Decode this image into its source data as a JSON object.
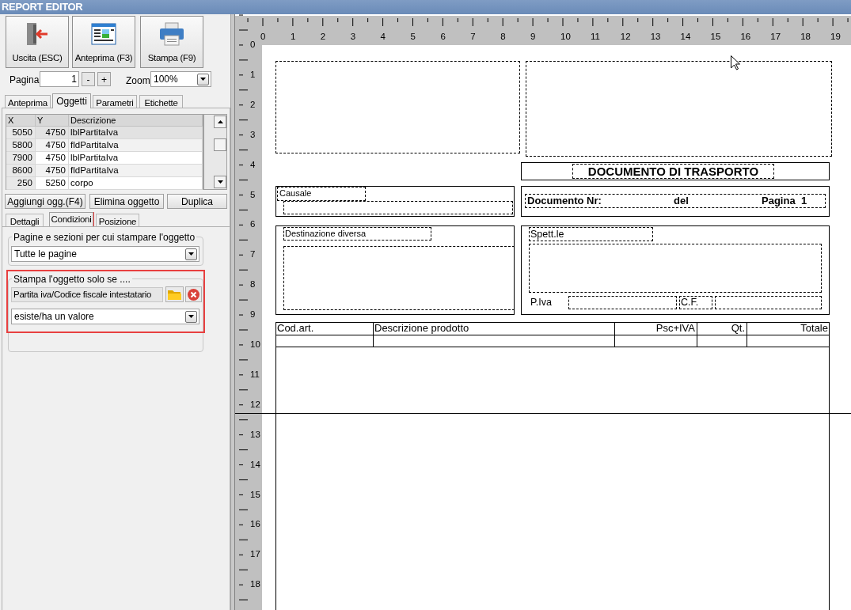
{
  "window": {
    "title": "REPORT EDITOR"
  },
  "toolbar": [
    {
      "kind": "exit",
      "label": "Uscita (ESC)"
    },
    {
      "kind": "preview",
      "label": "Anteprima (F3)"
    },
    {
      "kind": "print",
      "label": "Stampa (F9)"
    }
  ],
  "page_nav": {
    "label": "Pagina",
    "value": "1",
    "minus": "-",
    "plus": "+"
  },
  "zoom": {
    "label": "Zoom",
    "value": "100%"
  },
  "tabs": [
    {
      "label": "Anteprima",
      "selected": false
    },
    {
      "label": "Oggetti",
      "selected": true
    },
    {
      "label": "Parametri",
      "selected": false
    },
    {
      "label": "Etichette",
      "selected": false
    }
  ],
  "objects": {
    "columns": [
      "X",
      "Y",
      "Descrizione"
    ],
    "rows": [
      {
        "cells": [
          "5050",
          "4750",
          "lblPartitaIva"
        ],
        "selected": true
      },
      {
        "cells": [
          "5800",
          "4750",
          "fldPartitaIva"
        ],
        "selected": false
      },
      {
        "cells": [
          "7900",
          "4750",
          "lblPartitaIva"
        ],
        "selected": false
      },
      {
        "cells": [
          "8600",
          "4750",
          "fldPartitaIva"
        ],
        "selected": false
      },
      {
        "cells": [
          "250",
          "5250",
          "corpo"
        ],
        "selected": false
      }
    ]
  },
  "object_buttons": [
    "Aggiungi ogg.(F4)",
    "Elimina oggetto",
    "Duplica"
  ],
  "subtabs": [
    {
      "label": "Dettagli",
      "selected": false,
      "highlighted": false
    },
    {
      "label": "Condizioni",
      "selected": true,
      "highlighted": true
    },
    {
      "label": "Posizione",
      "selected": false,
      "highlighted": false
    }
  ],
  "pages_group": {
    "legend": "Pagine e sezioni per cui stampare l'oggetto",
    "value": "Tutte le pagine"
  },
  "condition_group": {
    "legend": "Stampa l'oggetto solo se ....",
    "field": "Partita iva/Codice fiscale intestatario",
    "operator": "esiste/ha un valore",
    "highlighted": true
  },
  "ruler": {
    "horizontal": [
      "0",
      "1",
      "2",
      "3",
      "4",
      "5",
      "6",
      "7",
      "8",
      "9",
      "10",
      "11",
      "12",
      "13",
      "14",
      "15",
      "16",
      "17",
      "18",
      "19"
    ],
    "vertical": [
      "0",
      "1",
      "2",
      "3",
      "4",
      "5",
      "6",
      "7",
      "8",
      "9",
      "10",
      "11",
      "12",
      "13",
      "14",
      "15",
      "16",
      "17",
      "18"
    ]
  },
  "report": {
    "title": "DOCUMENTO DI TRASPORTO",
    "causale": "Causale",
    "doc_nr": "Documento Nr:",
    "del": "del",
    "pagina": "Pagina",
    "pagina_value": "1",
    "destinazione": "Destinazione diversa",
    "spett": "Spett.le",
    "piva": "P.Iva",
    "cf": "C.F.",
    "columns": [
      "Cod.art.",
      "Descrizione prodotto",
      "Psc+IVA",
      "Qt.",
      "Totale"
    ]
  }
}
